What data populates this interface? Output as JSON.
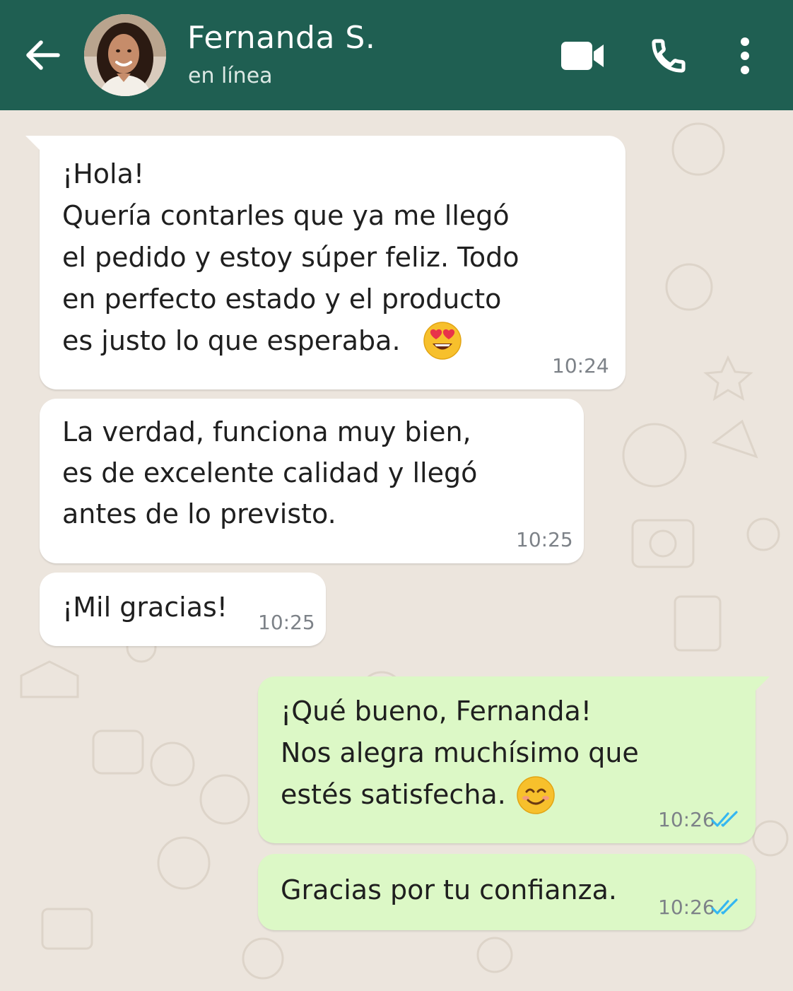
{
  "header": {
    "contact_name": "Fernanda S.",
    "status": "en línea",
    "icons": [
      "back-arrow-icon",
      "video-call-icon",
      "phone-icon",
      "more-vert-icon"
    ]
  },
  "messages": [
    {
      "direction": "incoming",
      "lines": [
        "¡Hola!",
        "Quería contarles que ya me llegó",
        "el pedido y estoy súper feliz. Todo",
        "en perfecto estado y el producto",
        "es justo lo que esperaba."
      ],
      "emoji": "heart-eyes-emoji",
      "time": "10:24"
    },
    {
      "direction": "incoming",
      "lines": [
        "La verdad, funciona muy bien,",
        "es de excelente calidad y llegó",
        "antes de lo previsto."
      ],
      "time": "10:25"
    },
    {
      "direction": "incoming",
      "lines": [
        "¡Mil gracias!"
      ],
      "time": "10:25"
    },
    {
      "direction": "outgoing",
      "lines": [
        "¡Qué bueno, Fernanda!",
        "Nos alegra muchísimo que",
        "estés satisfecha."
      ],
      "emoji": "smiling-face-emoji",
      "time": "10:26",
      "status": "read"
    },
    {
      "direction": "outgoing",
      "lines": [
        "Gracias por tu confianza."
      ],
      "time": "10:26",
      "status": "read"
    }
  ],
  "colors": {
    "header_bg": "#1f5f52",
    "chat_bg": "#ece5dd",
    "incoming_bubble": "#ffffff",
    "outgoing_bubble": "#dcf8c6",
    "read_tick": "#34b7f1"
  }
}
